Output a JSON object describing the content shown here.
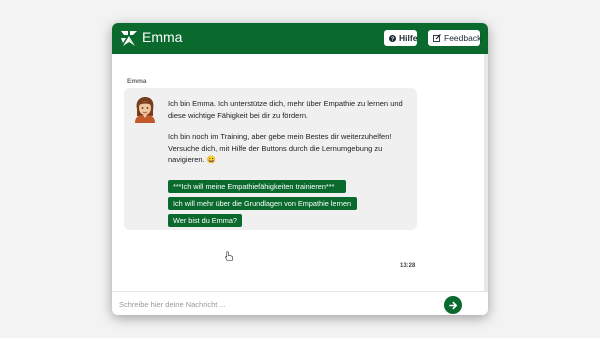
{
  "header": {
    "title": "Emma",
    "help_label": "Hilfe",
    "feedback_label": "Feedback"
  },
  "colors": {
    "accent": "#0a6a2e",
    "bubble": "#f0f0f1"
  },
  "chat": {
    "sender": "Emma",
    "message_1": "Ich bin Emma. Ich unterstütze dich, mehr über Empathie zu lernen und diese wichtige Fähigkeit bei dir zu fördern.",
    "message_2": "Ich bin noch im Training, aber gebe mein Bestes dir weiterzuhelfen! Versuche dich, mit Hilfe der Buttons durch die Lernumgebung zu navigieren. 😀",
    "choices": [
      "***Ich will meine Empathiefähigkeiten trainieren***",
      "Ich will mehr über die Grundlagen von Empathie lernen",
      "Wer bist du Emma?"
    ],
    "timestamp": "13:28"
  },
  "composer": {
    "placeholder": "Schreibe hier deine Nachricht ..."
  }
}
